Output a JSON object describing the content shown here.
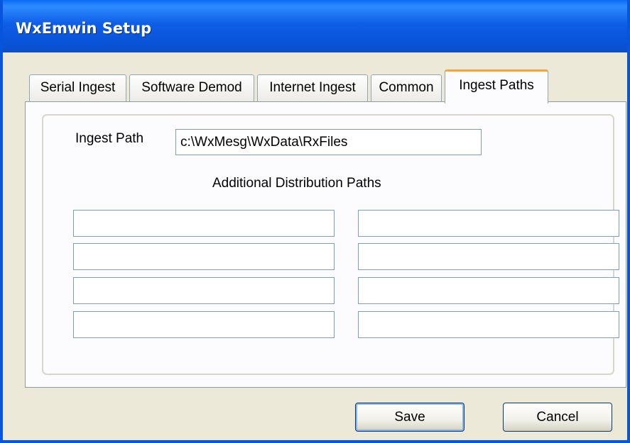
{
  "window": {
    "title": "WxEmwin Setup"
  },
  "tabs": [
    {
      "label": "Serial Ingest",
      "active": false
    },
    {
      "label": "Software Demod",
      "active": false
    },
    {
      "label": "Internet Ingest",
      "active": false
    },
    {
      "label": "Common",
      "active": false
    },
    {
      "label": "Ingest Paths",
      "active": true
    }
  ],
  "ingest_paths": {
    "ingest_path_label": "Ingest Path",
    "ingest_path_value": "c:\\WxMesg\\WxData\\RxFiles",
    "additional_label": "Additional Distribution Paths",
    "distribution_paths": [
      "",
      "",
      "",
      "",
      "",
      "",
      "",
      ""
    ]
  },
  "buttons": {
    "save": "Save",
    "cancel": "Cancel"
  },
  "colors": {
    "titlebar": "#0855dd",
    "active_tab_accent": "#f5a63a",
    "dialog_bg": "#ece9d8"
  }
}
